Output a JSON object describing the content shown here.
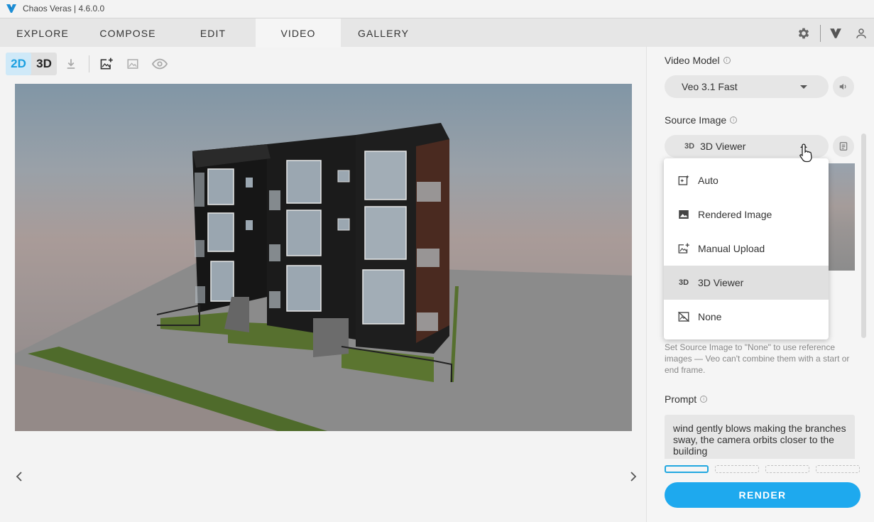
{
  "app": {
    "title": "Chaos Veras | 4.6.0.0",
    "accent": "#1ea9ee"
  },
  "tabs": [
    {
      "label": "EXPLORE"
    },
    {
      "label": "COMPOSE"
    },
    {
      "label": "EDIT"
    },
    {
      "label": "VIDEO",
      "active": true
    },
    {
      "label": "GALLERY"
    }
  ],
  "toolbar": {
    "mode_2d": "2D",
    "mode_3d": "3D"
  },
  "panel": {
    "video_model": {
      "label": "Video Model",
      "value": "Veo 3.1 Fast"
    },
    "source_image": {
      "label": "Source Image",
      "value": "3D Viewer"
    },
    "source_options": [
      {
        "label": "Auto",
        "icon": "auto-sparkle-icon"
      },
      {
        "label": "Rendered Image",
        "icon": "image-icon"
      },
      {
        "label": "Manual Upload",
        "icon": "upload-image-icon"
      },
      {
        "label": "3D Viewer",
        "icon": "3d-icon",
        "selected": true
      },
      {
        "label": "None",
        "icon": "no-image-icon"
      }
    ],
    "note": "Set Source Image to \"None\" to use reference images — Veo can't combine them with a start or end frame.",
    "prompt": {
      "label": "Prompt",
      "value": "wind gently blows making the branches sway, the camera orbits closer to the building"
    },
    "render_label": "RENDER"
  },
  "icons": {
    "three_d": "3D"
  }
}
